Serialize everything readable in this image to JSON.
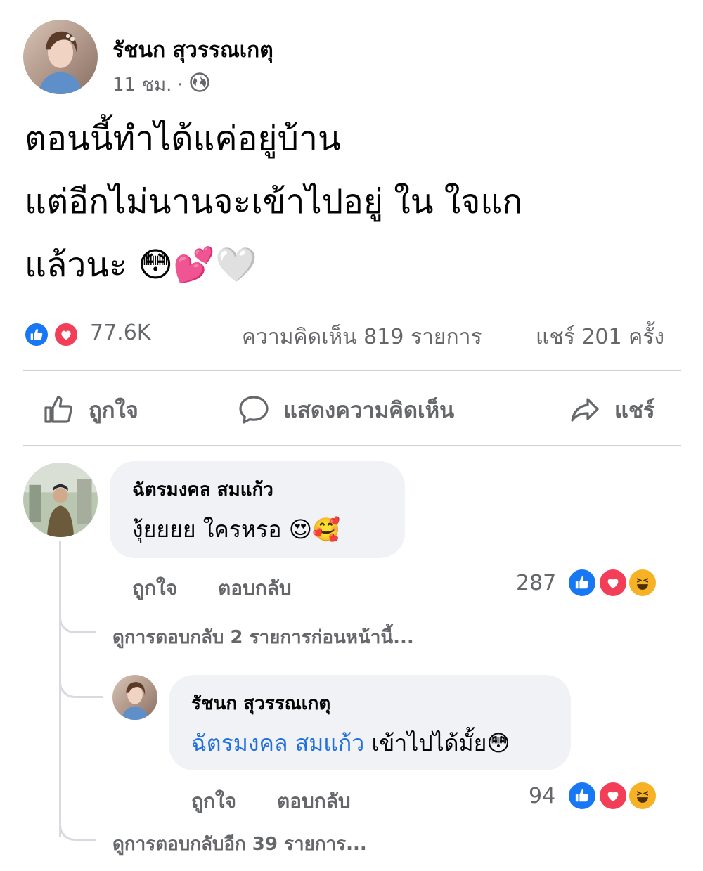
{
  "post": {
    "author": "รัชนก สุวรรณเกตุ",
    "time": "11 ชม.",
    "separator": "·",
    "privacy_icon": "globe-icon",
    "text_lines": [
      "ตอนนี้ทำได้แค่อยู่บ้าน",
      "แต่อีกไม่นานจะเข้าไปอยู่ ใน ใจแก",
      "แล้วนะ 😳💕🤍"
    ]
  },
  "stats": {
    "reactions_count": "77.6K",
    "comments": "ความคิดเห็น 819 รายการ",
    "shares": "แชร์ 201 ครั้ง"
  },
  "actions": {
    "like": "ถูกใจ",
    "comment": "แสดงความคิดเห็น",
    "share": "แชร์"
  },
  "comments": [
    {
      "author": "ฉัตรมงคล สมแก้ว",
      "text": "งุ้ยยยย ใครหรอ 😍🥰",
      "like_label": "ถูกใจ",
      "reply_label": "ตอบกลับ",
      "reaction_count": "287"
    }
  ],
  "view_previous": "ดูการตอบกลับ 2 รายการก่อนหน้านี้...",
  "reply": {
    "author": "รัชนก สุวรรณเกตุ",
    "mention": "ฉัตรมงคล สมแก้ว",
    "text": " เข้าไปได้มั้ย😳",
    "like_label": "ถูกใจ",
    "reply_label": "ตอบกลับ",
    "reaction_count": "94"
  },
  "view_more": "ดูการตอบกลับอีก 39 รายการ...",
  "colors": {
    "like_blue": "#1877f2",
    "love_red": "#f33e58",
    "haha_yellow": "#f7b125",
    "mention_blue": "#216fdb",
    "secondary_text": "#65676b",
    "bubble_bg": "#f0f2f5"
  }
}
